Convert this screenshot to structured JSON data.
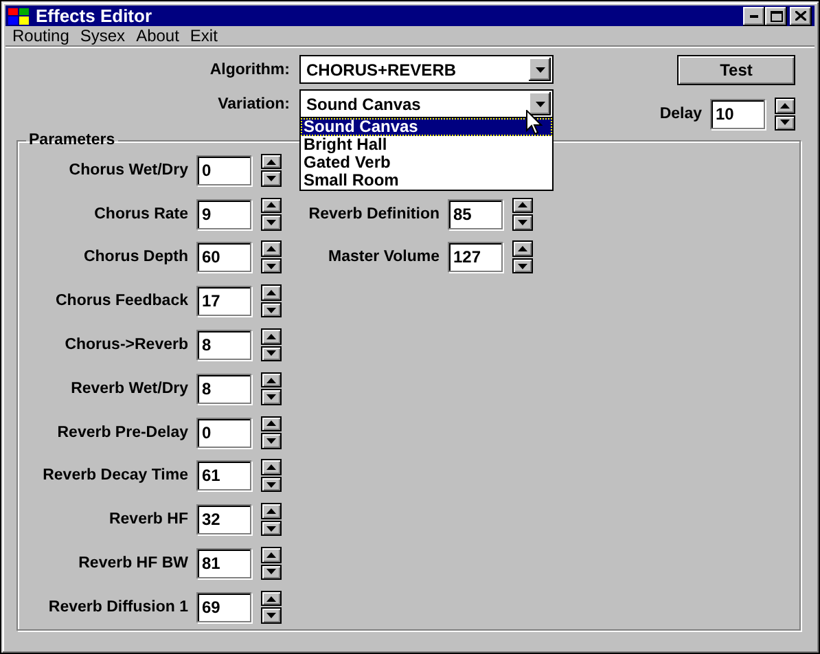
{
  "window": {
    "title": "Effects Editor"
  },
  "menu": [
    {
      "label": "Routing"
    },
    {
      "label": "Sysex"
    },
    {
      "label": "About"
    },
    {
      "label": "Exit"
    }
  ],
  "algorithm": {
    "label": "Algorithm:",
    "value": "CHORUS+REVERB"
  },
  "variation": {
    "label": "Variation:",
    "value": "Sound Canvas",
    "expanded": true,
    "options": [
      {
        "label": "Sound Canvas",
        "selected": true
      },
      {
        "label": "Bright Hall",
        "selected": false
      },
      {
        "label": "Gated Verb",
        "selected": false
      },
      {
        "label": "Small Room",
        "selected": false
      }
    ]
  },
  "test_button": "Test",
  "delay": {
    "label": "Delay",
    "value": "10"
  },
  "parameters": {
    "title": "Parameters",
    "left": [
      {
        "label": "Chorus Wet/Dry",
        "value": "0"
      },
      {
        "label": "Chorus Rate",
        "value": "9"
      },
      {
        "label": "Chorus Depth",
        "value": "60"
      },
      {
        "label": "Chorus Feedback",
        "value": "17"
      },
      {
        "label": "Chorus->Reverb",
        "value": "8"
      },
      {
        "label": "Reverb Wet/Dry",
        "value": "8"
      },
      {
        "label": "Reverb Pre-Delay",
        "value": "0"
      },
      {
        "label": "Reverb Decay Time",
        "value": "61"
      },
      {
        "label": "Reverb HF",
        "value": "32"
      },
      {
        "label": "Reverb HF BW",
        "value": "81"
      },
      {
        "label": "Reverb Diffusion 1",
        "value": "69"
      }
    ],
    "right": [
      {
        "label": "Reverb Definition",
        "value": "85"
      },
      {
        "label": "Master Volume",
        "value": "127"
      }
    ]
  }
}
